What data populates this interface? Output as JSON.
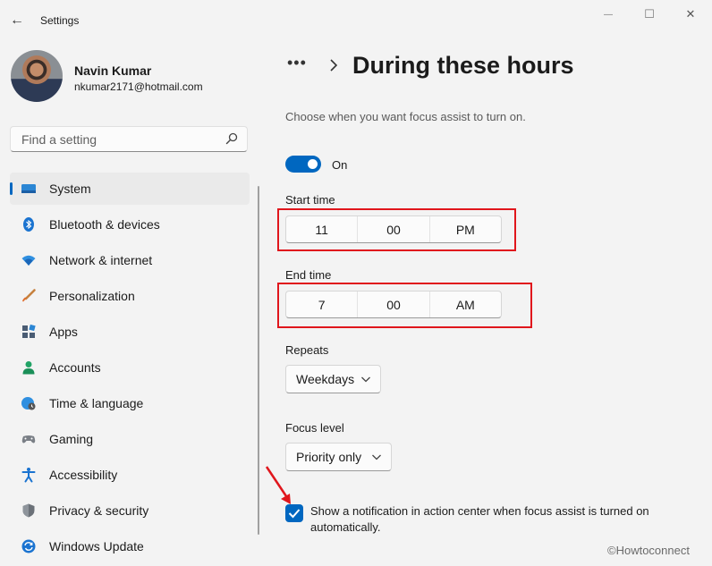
{
  "window": {
    "title": "Settings",
    "back_glyph": "←",
    "minimize_glyph": "—",
    "maximize_glyph": "☐",
    "close_glyph": "✕"
  },
  "user": {
    "name": "Navin Kumar",
    "email": "nkumar2171@hotmail.com"
  },
  "search": {
    "placeholder": "Find a setting",
    "value": ""
  },
  "sidebar": {
    "items": [
      {
        "label": "System",
        "icon": "system-icon",
        "active": true
      },
      {
        "label": "Bluetooth & devices",
        "icon": "bluetooth-icon"
      },
      {
        "label": "Network & internet",
        "icon": "wifi-icon"
      },
      {
        "label": "Personalization",
        "icon": "brush-icon"
      },
      {
        "label": "Apps",
        "icon": "apps-icon"
      },
      {
        "label": "Accounts",
        "icon": "person-icon"
      },
      {
        "label": "Time & language",
        "icon": "globe-clock-icon"
      },
      {
        "label": "Gaming",
        "icon": "gamepad-icon"
      },
      {
        "label": "Accessibility",
        "icon": "accessibility-icon"
      },
      {
        "label": "Privacy & security",
        "icon": "shield-icon"
      },
      {
        "label": "Windows Update",
        "icon": "update-icon"
      }
    ]
  },
  "main": {
    "breadcrumb_more": "•••",
    "title": "During these hours",
    "description": "Choose when you want focus assist to turn on.",
    "toggle": {
      "state": "On",
      "on": true
    },
    "start_time": {
      "label": "Start time",
      "hour": "11",
      "minute": "00",
      "period": "PM"
    },
    "end_time": {
      "label": "End time",
      "hour": "7",
      "minute": "00",
      "period": "AM"
    },
    "repeats": {
      "label": "Repeats",
      "value": "Weekdays"
    },
    "focus_level": {
      "label": "Focus level",
      "value": "Priority only"
    },
    "notification_checkbox": {
      "checked": true,
      "label": "Show a notification in action center when focus assist is turned on automatically."
    }
  },
  "watermark": "©Howtoconnect",
  "colors": {
    "accent": "#0067c0",
    "highlight": "#e0161c",
    "background": "#f3f3f3"
  }
}
